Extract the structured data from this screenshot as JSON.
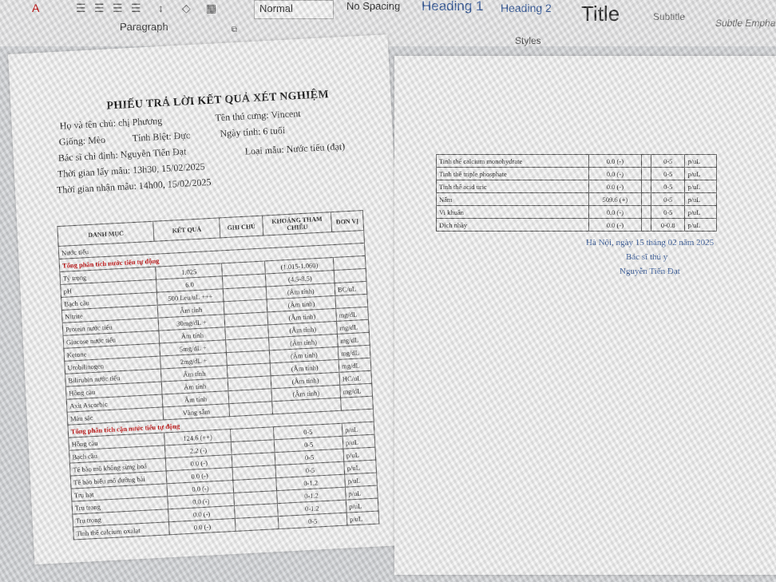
{
  "ribbon": {
    "paragraph_label": "Paragraph",
    "styles_label": "Styles",
    "style_box_value": "Normal",
    "styles": [
      "No Spacing",
      "Heading 1",
      "Heading 2",
      "Title",
      "Subtitle",
      "Subtle Emphas"
    ]
  },
  "report": {
    "title": "PHIẾU TRẢ LỜI KẾT QUẢ XÉT NGHIỆM",
    "owner": "Họ và tên chủ: chị Phương",
    "pet_name": "Tên thú cưng: Vincent",
    "species": "Giống: Mèo",
    "sex": "Tính Biệt: Đực",
    "age": "Ngày tính: 6 tuổi",
    "doctor": "Bác sĩ chỉ định: Nguyễn Tiến Đạt",
    "sample_type": "Loại mẫu: Nước tiểu (đạt)",
    "sample_time": "Thời gian lấy mẫu: 13h30, 15/02/2025",
    "receive_time": "Thời gian nhận mẫu: 14h00, 15/02/2025"
  },
  "table1": {
    "headers": [
      "DANH MỤC",
      "KẾT QUẢ",
      "GHI CHÚ",
      "KHOẢNG THAM CHIẾU",
      "ĐƠN VỊ"
    ],
    "top_row": "Nước tiểu",
    "section1": "Tổng phân tích nước tiểu tự động",
    "rows1": [
      [
        "Tỷ trọng",
        "1.025",
        "",
        "(1.015-1.060)",
        ""
      ],
      [
        "pH",
        "6.0",
        "",
        "(4.5-8.5)",
        ""
      ],
      [
        "Bạch cầu",
        "500 Leu/uL +++",
        "",
        "(Âm tính)",
        "BC/uL"
      ],
      [
        "Nitrite",
        "Âm tính",
        "",
        "(Âm tính)",
        ""
      ],
      [
        "Protein nước tiểu",
        "30mg/dL +",
        "",
        "(Âm tính)",
        "mg/dL"
      ],
      [
        "Glucose nước tiểu",
        "Âm tính",
        "",
        "(Âm tính)",
        "mg/dL"
      ],
      [
        "Ketone",
        "5mg/dL +",
        "",
        "(Âm tính)",
        "mg/dL"
      ],
      [
        "Urobilinogen",
        "2mg/dL +",
        "",
        "(Âm tính)",
        "mg/dL"
      ],
      [
        "Bilirubin nước tiểu",
        "Âm tính",
        "",
        "(Âm tính)",
        "mg/dL"
      ],
      [
        "Hồng cầu",
        "Âm tính",
        "",
        "(Âm tính)",
        "HC/uL"
      ],
      [
        "Axit Ascorbic",
        "Âm tính",
        "",
        "(Âm tính)",
        "mg/dL"
      ],
      [
        "Màu sắc",
        "Vàng sẫm",
        "",
        "",
        ""
      ]
    ],
    "section2": "Tổng phân tích cặn nước tiểu tự động",
    "rows2": [
      [
        "Hồng cầu",
        "124.6 (++)",
        "",
        "0-5",
        "p/uL"
      ],
      [
        "Bạch cầu",
        "2.2 (-)",
        "",
        "0-5",
        "p/uL"
      ],
      [
        "Tế bào mô không sừng hoá",
        "0.0 (-)",
        "",
        "0-5",
        "p/uL"
      ],
      [
        "Tế bào biểu mô đường bài",
        "0.0 (-)",
        "",
        "0-5",
        "p/uL"
      ],
      [
        "Trụ hạt",
        "0.0 (-)",
        "",
        "0-1.2",
        "p/uL"
      ],
      [
        "Trụ trong",
        "0.0 (-)",
        "",
        "0-1.2",
        "p/uL"
      ],
      [
        "Trụ trong",
        "0.0 (-)",
        "",
        "0-1.2",
        "p/uL"
      ],
      [
        "Tinh thể calcium oxalat",
        "0.0 (-)",
        "",
        "0-5",
        "p/uL"
      ]
    ]
  },
  "table2": {
    "rows": [
      [
        "Tinh thể calcium monohydrate",
        "0.0 (-)",
        "",
        "0-5",
        "p/uL"
      ],
      [
        "Tinh thể triple phosphate",
        "0.0 (-)",
        "",
        "0-5",
        "p/uL"
      ],
      [
        "Tinh thể acid uric",
        "0.0 (-)",
        "",
        "0-5",
        "p/uL"
      ],
      [
        "Nấm",
        "509.6 (+)",
        "",
        "0-5",
        "p/uL"
      ],
      [
        "Vi khuẩn",
        "0.0 (-)",
        "",
        "0-5",
        "p/uL"
      ],
      [
        "Dịch nhầy",
        "0.0 (-)",
        "",
        "0-0.8",
        "p/uL"
      ]
    ]
  },
  "signature": {
    "place_date": "Hà Nội, ngày 15 tháng 02 năm 2025",
    "role": "Bác sĩ thú y",
    "name": "Nguyễn Tiến Đạt"
  }
}
